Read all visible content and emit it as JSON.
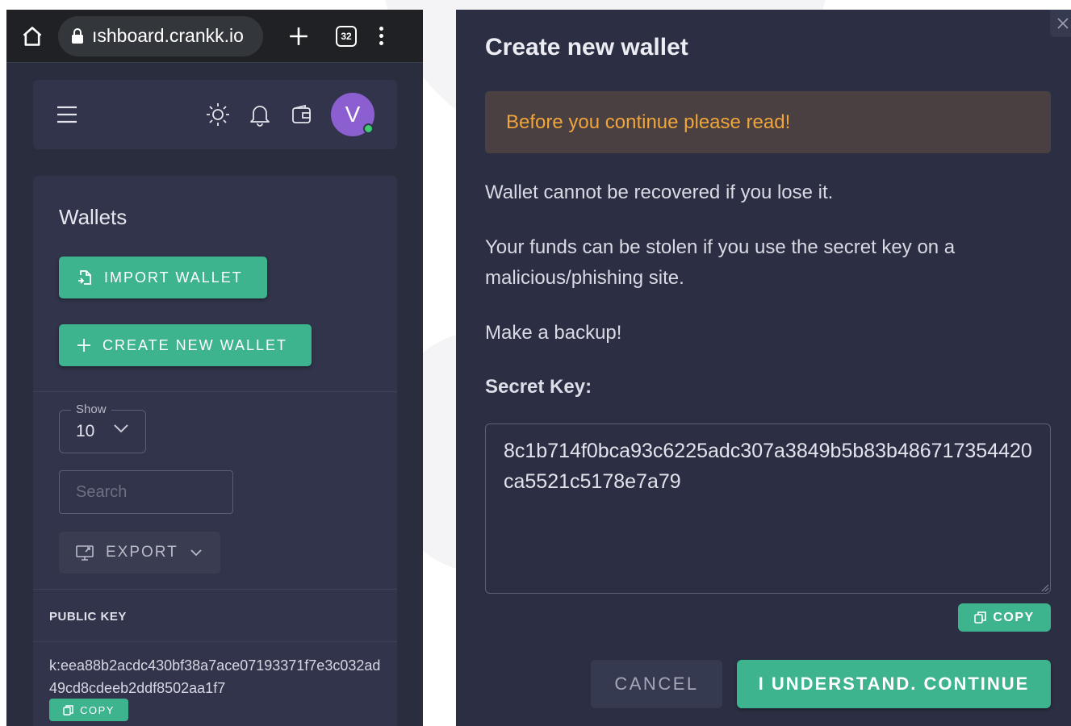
{
  "browser": {
    "url": "ıshboard.crankk.io",
    "tab_count": "32"
  },
  "wallets_page": {
    "title": "Wallets",
    "import_wallet_label": "IMPORT WALLET",
    "create_wallet_label": "CREATE NEW WALLET",
    "show_label": "Show",
    "show_value": "10",
    "search_placeholder": "Search",
    "export_label": "EXPORT",
    "public_key_header": "PUBLIC KEY",
    "public_key_value": "k:eea88b2acdc430bf38a7ace07193371f7e3c032ad49cd8cdeeb2ddf8502aa1f7",
    "copy_label": "COPY"
  },
  "user": {
    "avatar_initial": "V",
    "status": "online"
  },
  "dialog": {
    "title": "Create new wallet",
    "warning": "Before you continue please read!",
    "line1": "Wallet cannot be recovered if you lose it.",
    "line2": "Your funds can be stolen if you use the secret key on a malicious/phishing site.",
    "line3": "Make a backup!",
    "secret_key_label": "Secret Key:",
    "secret_key_value": "8c1b714f0bca93c6225adc307a3849b5b83b486717354420ca5521c5178e7a79",
    "copy_label": "COPY",
    "cancel_label": "CANCEL",
    "continue_label": "I UNDERSTAND. CONTINUE"
  },
  "colors": {
    "accent": "#3db38e",
    "panel": "#31344a",
    "warning_text": "#f0a53a",
    "avatar": "#8c5fd0"
  },
  "icons": [
    "home-icon",
    "lock-icon",
    "plus-icon",
    "tabs-icon",
    "kebab-menu-icon",
    "hamburger-icon",
    "sun-icon",
    "bell-icon",
    "wallet-icon",
    "import-file-icon",
    "plus-icon",
    "chevron-down-icon",
    "export-screen-icon",
    "copy-icon",
    "close-icon"
  ]
}
